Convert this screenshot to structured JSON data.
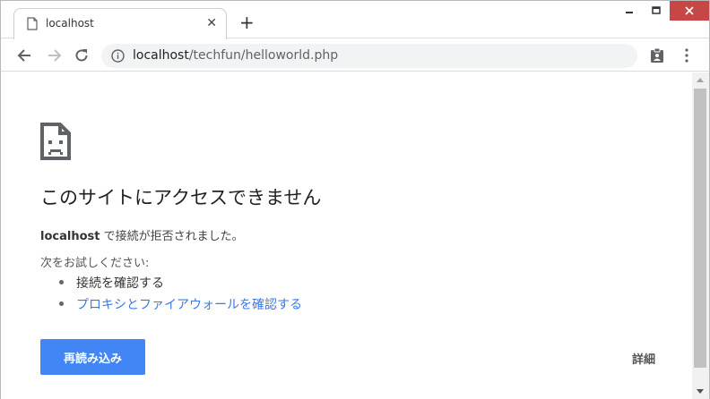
{
  "tab": {
    "title": "localhost",
    "close": "✕",
    "new_tab": "+"
  },
  "address": {
    "host": "localhost",
    "path": "/techfun/helloworld.php"
  },
  "error": {
    "heading": "このサイトにアクセスできません",
    "host": "localhost",
    "message": " で接続が拒否されました。",
    "try_label": "次をお試しください:",
    "suggestions": [
      "接続を確認する",
      "プロキシとファイアウォールを確認する"
    ],
    "reload_label": "再読み込み",
    "details_label": "詳細"
  },
  "colors": {
    "accent": "#4285f4",
    "link": "#3b78e7",
    "close": "#c74747"
  },
  "icons": [
    "page-icon",
    "info-icon",
    "back-icon",
    "forward-icon",
    "reload-icon",
    "clipboard-icon",
    "menu-icon",
    "sad-page-icon"
  ]
}
